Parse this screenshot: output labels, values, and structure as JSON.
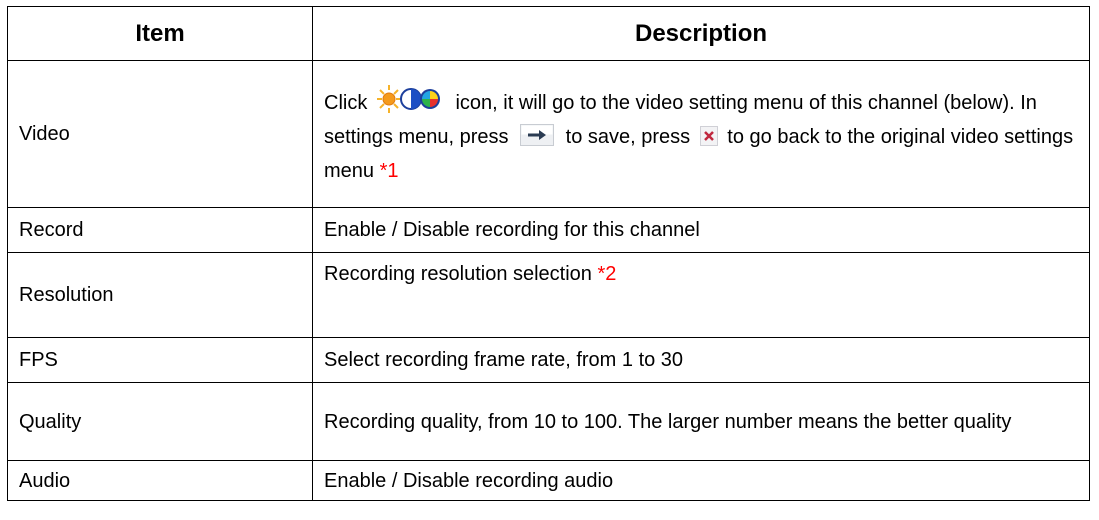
{
  "table": {
    "headers": {
      "item": "Item",
      "description": "Description"
    },
    "rows": {
      "video": {
        "item": "Video",
        "desc": {
          "part1": "Click",
          "part2": "icon, it will go to the video setting menu of this channel (below). In settings menu, press",
          "part3": "to save, press",
          "part4": "to go back to the original video settings menu",
          "note": "*1"
        }
      },
      "record": {
        "item": "Record",
        "desc": "Enable / Disable recording for this channel"
      },
      "resolution": {
        "item": "Resolution",
        "desc": "Recording resolution selection",
        "note": "*2"
      },
      "fps": {
        "item": "FPS",
        "desc": "Select recording frame rate, from 1 to 30"
      },
      "quality": {
        "item": "Quality",
        "desc": "Recording quality, from 10 to 100. The larger number means the better quality"
      },
      "audio": {
        "item": "Audio",
        "desc": "Enable / Disable recording audio"
      }
    }
  },
  "icons": {
    "video_settings": "brightness-contrast-color-icon",
    "save": "arrow-right-save-icon",
    "close": "close-x-icon"
  },
  "colors": {
    "note": "#ff0000",
    "border": "#000000"
  }
}
